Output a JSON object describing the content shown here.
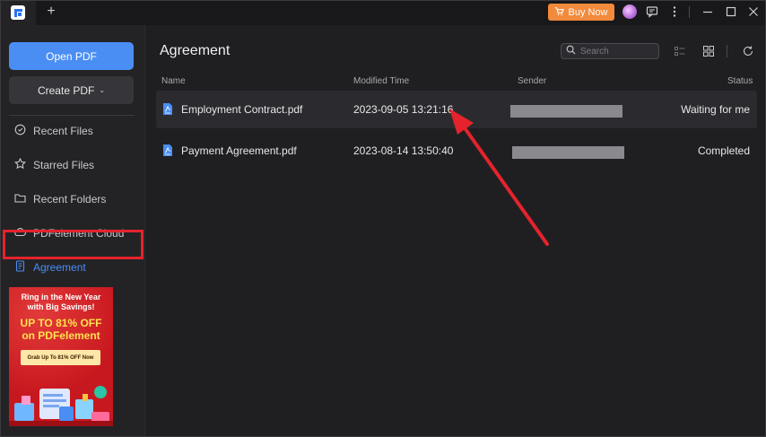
{
  "titlebar": {
    "new_tab_glyph": "+",
    "buy_now": "Buy Now",
    "icons": [
      "app-logo-icon",
      "plus-icon",
      "cart-icon",
      "avatar",
      "message-icon",
      "more-icon",
      "minimize-icon",
      "maximize-icon",
      "close-icon"
    ]
  },
  "sidebar": {
    "open_pdf": "Open PDF",
    "create_pdf": "Create PDF",
    "create_chevron": "⌄",
    "items": [
      {
        "label": "Recent Files",
        "icon": "clock-icon"
      },
      {
        "label": "Starred Files",
        "icon": "star-icon"
      },
      {
        "label": "Recent Folders",
        "icon": "folder-icon"
      },
      {
        "label": "PDFelement Cloud",
        "icon": "cloud-icon"
      },
      {
        "label": "Agreement",
        "icon": "agreement-icon",
        "active": true
      }
    ]
  },
  "banner": {
    "line1": "Ring in the New Year",
    "line2": "with Big Savings!",
    "headline1": "UP TO 81% OFF",
    "headline2": "on PDFelement",
    "cta": "Grab Up To 81% OFF Now"
  },
  "main": {
    "title": "Agreement",
    "search_placeholder": "Search",
    "columns": {
      "name": "Name",
      "modified": "Modified Time",
      "sender": "Sender",
      "status": "Status"
    },
    "rows": [
      {
        "name": "Employment Contract.pdf",
        "modified": "2023-09-05 13:21:16",
        "status": "Waiting for me",
        "selected": true
      },
      {
        "name": "Payment Agreement.pdf",
        "modified": "2023-08-14 13:50:40",
        "status": "Completed",
        "selected": false
      }
    ]
  },
  "colors": {
    "accent": "#4a8ef4",
    "buy": "#f28a3c",
    "annotation": "#e4232c",
    "background": "#1f1f22",
    "sidebar": "#232326"
  }
}
